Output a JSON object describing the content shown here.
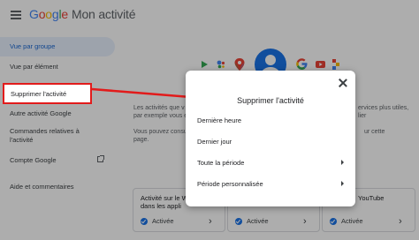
{
  "header": {
    "brand": {
      "g": "G",
      "o1": "o",
      "o2": "o",
      "g2": "g",
      "l": "l",
      "e": "e"
    },
    "product": "Mon activité"
  },
  "sidebar": {
    "items": [
      {
        "label": "Vue par groupe"
      },
      {
        "label": "Vue par élément"
      },
      {
        "label": "Supprimer l'activité"
      },
      {
        "label": "Autre activité Google"
      },
      {
        "label": "Commandes relatives à l'activité"
      },
      {
        "label": "Compte Google"
      },
      {
        "label": "Aide et commentaires"
      }
    ]
  },
  "main": {
    "description_lines": [
      "Les activités que v",
      "par exemple vous e"
    ],
    "description_lines_right": [
      "ervices plus utiles,",
      "lier"
    ],
    "description2_lines": [
      "Vous pouvez consu",
      "page."
    ],
    "description2_right": "ur cette",
    "cards": [
      {
        "title_lines": [
          "Activité sur le W",
          "dans les appli"
        ],
        "status": "Activée"
      },
      {
        "title_lines": [
          ""
        ],
        "status": "Activée"
      },
      {
        "title_lines": [
          "YouTube"
        ],
        "status": "Activée"
      }
    ]
  },
  "dialog": {
    "title": "Supprimer l'activité",
    "options": [
      {
        "label": "Dernière heure",
        "has_submenu": false
      },
      {
        "label": "Dernier jour",
        "has_submenu": false
      },
      {
        "label": "Toute la période",
        "has_submenu": true
      },
      {
        "label": "Période personnalisée",
        "has_submenu": true
      }
    ]
  },
  "annotation": {
    "highlight_color": "#e21b1b"
  },
  "colors": {
    "accent": "#1a73e8",
    "active_nav_bg": "#e8f0fe"
  }
}
